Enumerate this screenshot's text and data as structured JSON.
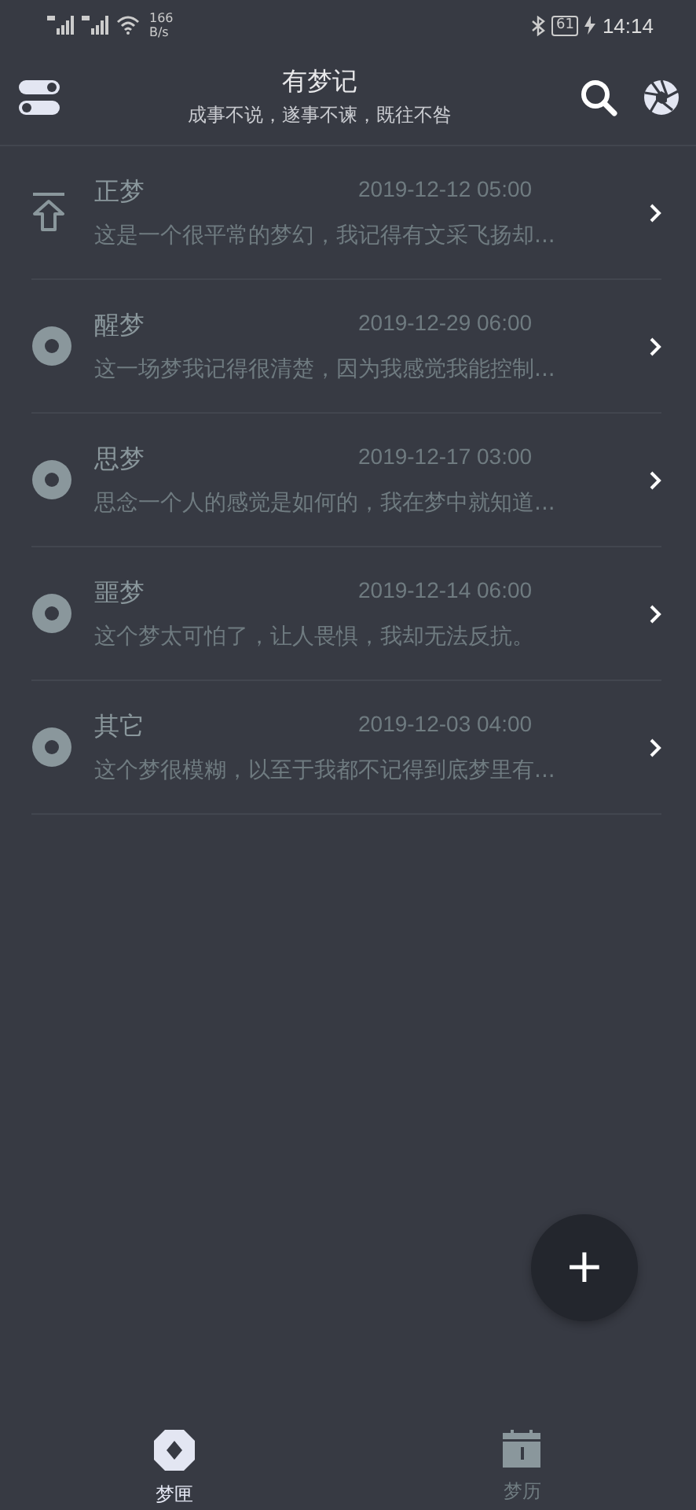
{
  "status_bar": {
    "net_speed": "166",
    "net_unit": "B/s",
    "battery": "61",
    "time": "14:14"
  },
  "header": {
    "title": "有梦记",
    "subtitle": "成事不说，遂事不谏，既往不咎"
  },
  "dreams": [
    {
      "kind": "pinned",
      "title": "正梦",
      "date": "2019-12-12 05:00",
      "preview": "这是一个很平常的梦幻，我记得有文采飞扬却..."
    },
    {
      "kind": "normal",
      "title": "醒梦",
      "date": "2019-12-29 06:00",
      "preview": "这一场梦我记得很清楚，因为我感觉我能控制..."
    },
    {
      "kind": "normal",
      "title": "思梦",
      "date": "2019-12-17 03:00",
      "preview": "思念一个人的感觉是如何的，我在梦中就知道..."
    },
    {
      "kind": "normal",
      "title": "噩梦",
      "date": "2019-12-14 06:00",
      "preview": "这个梦太可怕了，让人畏惧，我却无法反抗。"
    },
    {
      "kind": "normal",
      "title": "其它",
      "date": "2019-12-03 04:00",
      "preview": "这个梦很模糊，以至于我都不记得到底梦里有..."
    }
  ],
  "fab": {
    "label": "+"
  },
  "tabs": [
    {
      "label": "梦匣",
      "kind": "box",
      "selected": true
    },
    {
      "label": "梦历",
      "kind": "calendar",
      "selected": false
    }
  ]
}
